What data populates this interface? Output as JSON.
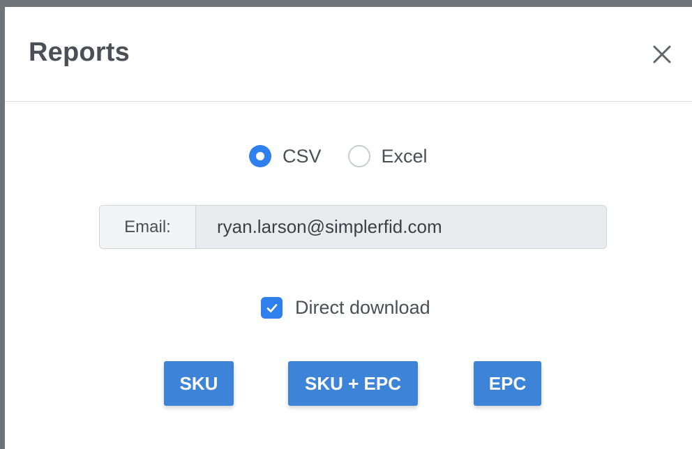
{
  "modal": {
    "title": "Reports",
    "close_icon": "close-icon"
  },
  "format": {
    "options": [
      {
        "label": "CSV",
        "checked": true
      },
      {
        "label": "Excel",
        "checked": false
      }
    ]
  },
  "email": {
    "prefix_label": "Email:",
    "value": "ryan.larson@simplerfid.com"
  },
  "direct_download": {
    "label": "Direct download",
    "checked": true,
    "icon": "checkmark-icon"
  },
  "buttons": {
    "sku": "SKU",
    "sku_epc": "SKU + EPC",
    "epc": "EPC"
  },
  "colors": {
    "accent": "#2f80ed",
    "button": "#3d84d9",
    "title": "#4a5056"
  }
}
